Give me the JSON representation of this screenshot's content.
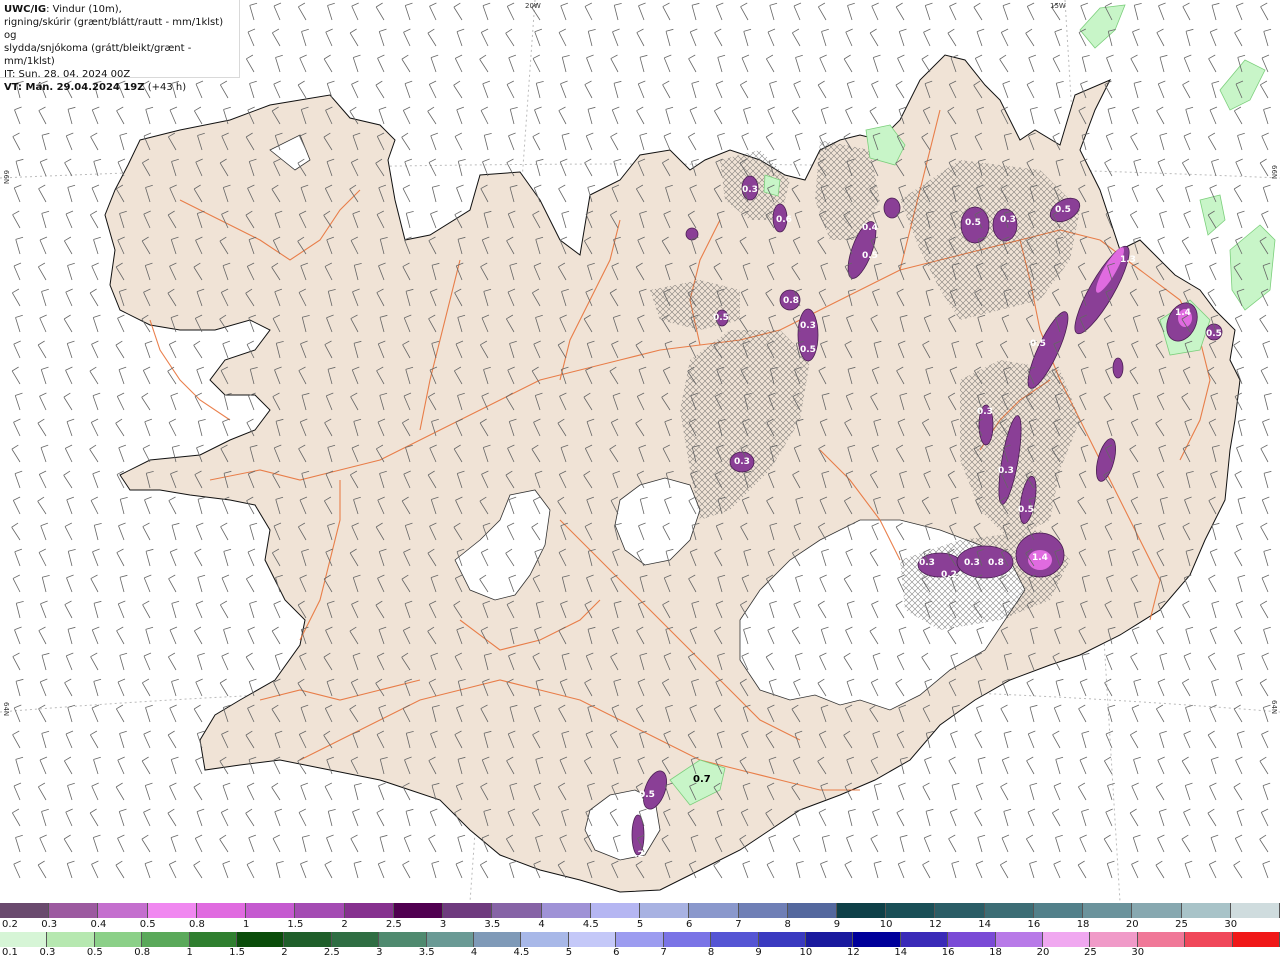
{
  "header": {
    "product_code": "UWC/IG",
    "line1_rest": ": Vindur (10m),",
    "line2": "rigning/skúrir (grænt/blátt/rautt - mm/1klst) og",
    "line3": "slydda/snjókoma (grátt/bleikt/grænt - mm/1klst)",
    "init_time": "IT: Sun. 28. 04. 2024 00Z",
    "valid_prefix": "VT: Mán. 29.04.2024 19Z",
    "valid_offset": " (+43 h)"
  },
  "graticule": {
    "lon_labels": [
      "20W",
      "15W"
    ],
    "lat_labels_left": [
      "66N",
      "64N"
    ],
    "lat_labels_right": [
      "66N",
      "64N"
    ]
  },
  "snow_labels": [
    "0.3",
    "0.5",
    "0.5",
    "0.4",
    "0.5",
    "0.3",
    "0.6",
    "0.8",
    "0.5",
    "0.3",
    "0.5",
    "1.3",
    "1.4",
    "0.5",
    "0.3",
    "0.3",
    "0.5",
    "0.5",
    "0.3",
    "0.2",
    "0.3",
    "0.8",
    "1.4",
    "0.5",
    "0.2",
    "0.3"
  ],
  "rain_labels": [
    "0.7"
  ],
  "scale_top": {
    "labels": [
      "0.2",
      "0.3",
      "0.4",
      "0.5",
      "0.8",
      "1",
      "1.5",
      "2",
      "2.5",
      "3",
      "3.5",
      "4",
      "4.5",
      "5",
      "6",
      "7",
      "8",
      "9",
      "10",
      "12",
      "14",
      "16",
      "18",
      "20",
      "25",
      "30"
    ],
    "colors": [
      "#6a4a6e",
      "#9c5aa0",
      "#c46fce",
      "#f088f0",
      "#e06be0",
      "#c55ad0",
      "#a44bb3",
      "#86318f",
      "#500050",
      "#6e3a7e",
      "#8663a6",
      "#9f92d6",
      "#b5b6f2",
      "#a8b2e2",
      "#8a98cc",
      "#6f7fb6",
      "#54689e",
      "#0e4048",
      "#1a4f57",
      "#2a5d66",
      "#3c6d75",
      "#52808a",
      "#6b939c",
      "#87a8b0",
      "#a8c3c8",
      "#cfdcde"
    ]
  },
  "scale_bottom": {
    "labels": [
      "0.1",
      "0.3",
      "0.5",
      "0.8",
      "1",
      "1.5",
      "2",
      "2.5",
      "3",
      "3.5",
      "4",
      "4.5",
      "5",
      "6",
      "7",
      "8",
      "9",
      "10",
      "12",
      "14",
      "16",
      "18",
      "20",
      "25",
      "30"
    ],
    "colors": [
      "#d6f5d6",
      "#b6e8b0",
      "#8bd088",
      "#5aa95a",
      "#2f7f2f",
      "#0a4d0a",
      "#1f5f2a",
      "#2f6e43",
      "#4f8a6f",
      "#6a9a95",
      "#7f9ab8",
      "#a8b8e8",
      "#c4c8f8",
      "#9c9cf0",
      "#7a74e6",
      "#5555d4",
      "#3a3ac0",
      "#1a1a9e",
      "#00009a",
      "#3a2ab8",
      "#7a4ad6",
      "#b87ae8",
      "#f0a8f0",
      "#f09ac8",
      "#f07898",
      "#f0485a",
      "#f01818"
    ]
  },
  "colors": {
    "land": "#f0e3d6",
    "glacier": "#ffffff",
    "road": "#e8733a",
    "coast": "#000000",
    "snow": "#8a3f96",
    "rain": "#c8f5c8",
    "wind_barb": "#666666"
  }
}
